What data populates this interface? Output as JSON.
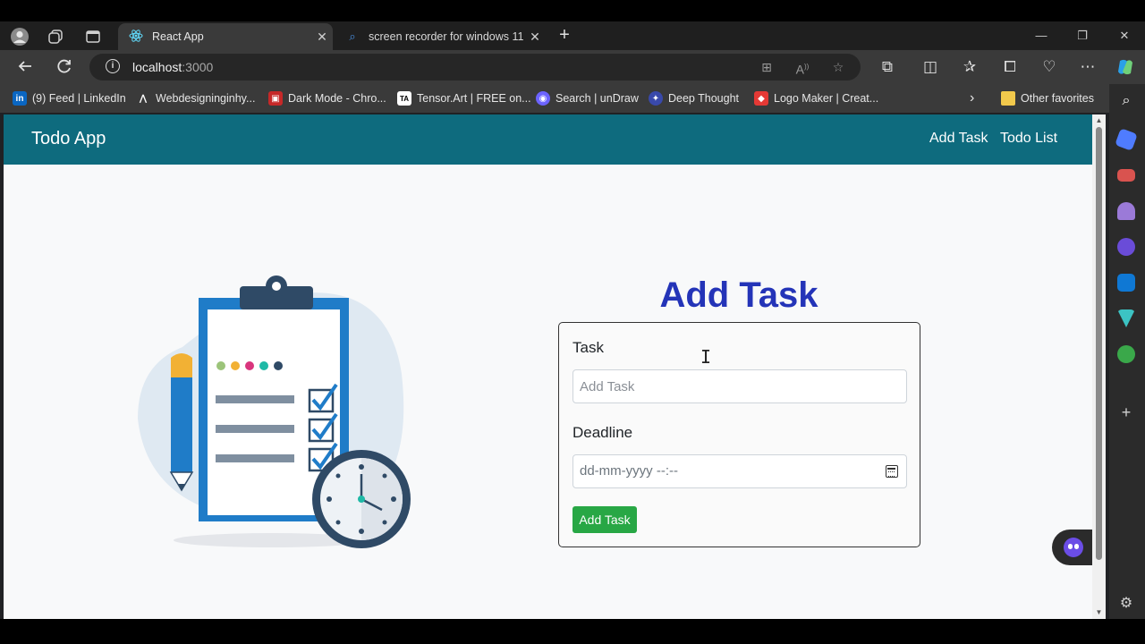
{
  "browser": {
    "tabs": [
      {
        "title": "React App",
        "active": true,
        "favicon": "react-icon"
      },
      {
        "title": "screen recorder for windows 11",
        "active": false,
        "favicon": "search-icon"
      }
    ],
    "address": {
      "host": "localhost",
      "port": ":3000"
    },
    "bookmarks": [
      {
        "label": "(9) Feed | LinkedIn",
        "icon": "linkedin-icon",
        "color": "#0a66c2",
        "glyph": "in"
      },
      {
        "label": "Webdesigninginhy...",
        "icon": "webdesign-icon",
        "color": "#3a3a3a",
        "glyph": "⋀"
      },
      {
        "label": "Dark Mode - Chro...",
        "icon": "dark-mode-icon",
        "color": "#c62828",
        "glyph": "▣"
      },
      {
        "label": "Tensor.Art | FREE on...",
        "icon": "tensorart-icon",
        "color": "#ffffff",
        "glyph": "TA"
      },
      {
        "label": "Search | unDraw",
        "icon": "undraw-icon",
        "color": "#6c63ff",
        "glyph": "◉"
      },
      {
        "label": "Deep Thought",
        "icon": "deep-thought-icon",
        "color": "#3949ab",
        "glyph": "✦"
      },
      {
        "label": "Logo Maker | Creat...",
        "icon": "logo-maker-icon",
        "color": "#e53935",
        "glyph": "◆"
      }
    ],
    "other_favorites": "Other favorites"
  },
  "app": {
    "brand": "Todo App",
    "nav": {
      "add_task": "Add Task",
      "todo_list": "Todo List"
    },
    "heading": "Add Task",
    "form": {
      "task_label": "Task",
      "task_placeholder": "Add Task",
      "deadline_label": "Deadline",
      "deadline_placeholder": "dd-mm-yyyy --:--",
      "submit_label": "Add Task"
    }
  },
  "colors": {
    "navbar": "#0e6b7e",
    "heading": "#2434b8",
    "button": "#28a745"
  }
}
